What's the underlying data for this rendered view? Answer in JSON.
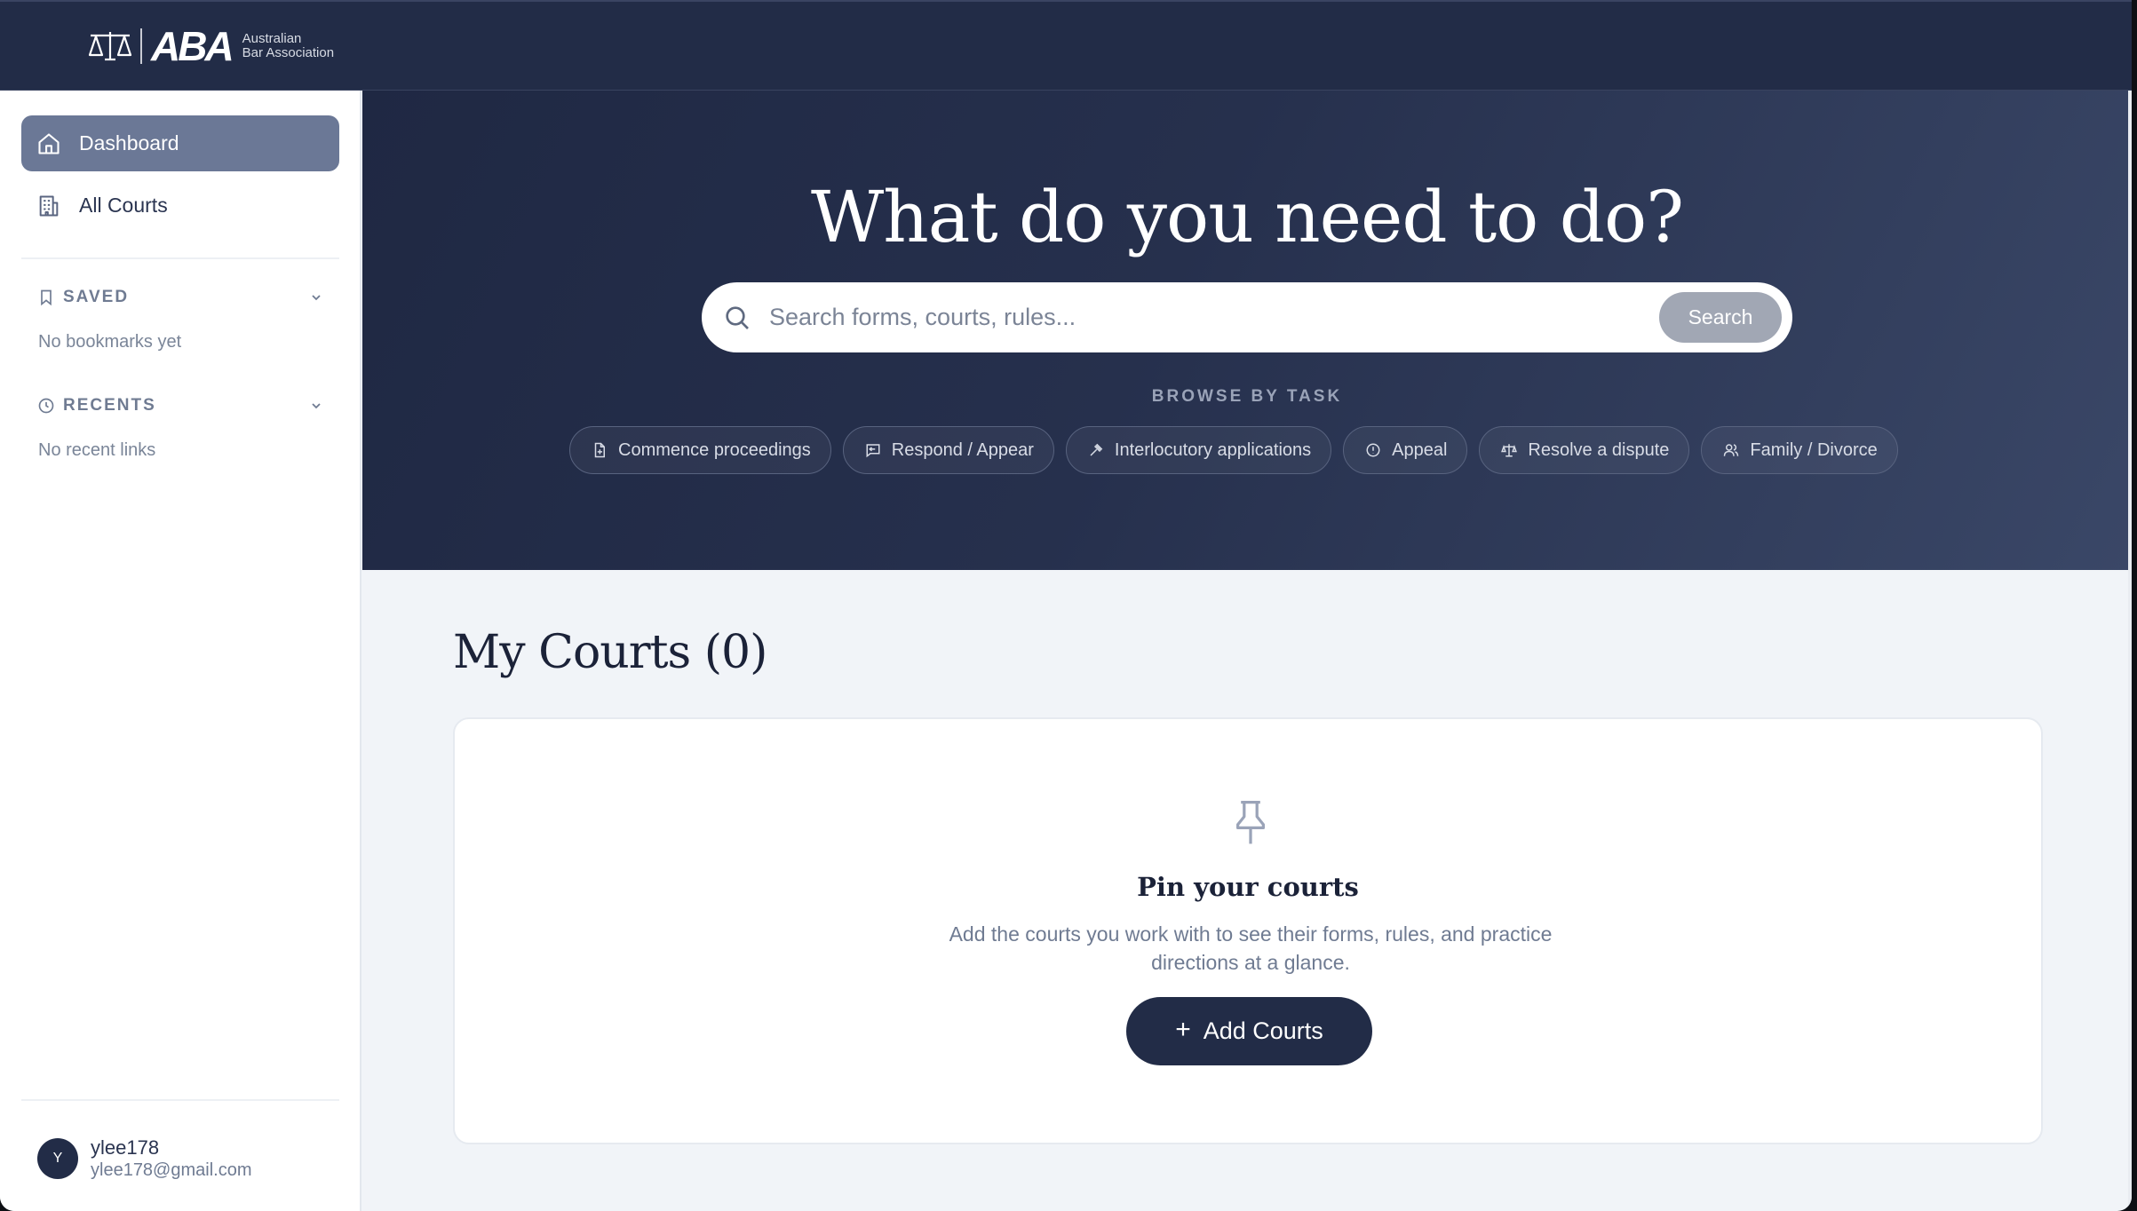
{
  "brand": {
    "mark": "ABA",
    "org_line1": "Australian",
    "org_line2": "Bar Association"
  },
  "sidebar": {
    "items": [
      {
        "label": "Dashboard",
        "icon": "home-icon",
        "active": true
      },
      {
        "label": "All Courts",
        "icon": "building-icon",
        "active": false
      }
    ],
    "saved": {
      "title": "SAVED",
      "empty": "No bookmarks yet"
    },
    "recents": {
      "title": "RECENTS",
      "empty": "No recent links"
    },
    "user": {
      "initial": "Y",
      "name": "ylee178",
      "email": "ylee178@gmail.com"
    }
  },
  "hero": {
    "title": "What do you need to do?",
    "search": {
      "placeholder": "Search forms, courts, rules...",
      "button": "Search"
    },
    "browse_label": "BROWSE BY TASK",
    "chips": [
      {
        "label": "Commence proceedings",
        "icon": "file-plus-icon"
      },
      {
        "label": "Respond / Appear",
        "icon": "message-reply-icon"
      },
      {
        "label": "Interlocutory applications",
        "icon": "gavel-icon"
      },
      {
        "label": "Appeal",
        "icon": "alert-circle-icon"
      },
      {
        "label": "Resolve a dispute",
        "icon": "scale-icon"
      },
      {
        "label": "Family / Divorce",
        "icon": "users-icon"
      }
    ]
  },
  "main": {
    "title": "My Courts (0)",
    "empty_card": {
      "heading": "Pin your courts",
      "description": "Add the courts you work with to see their forms, rules, and practice directions at a glance.",
      "button": "Add Courts",
      "button_icon": "+"
    }
  },
  "colors": {
    "navy": "#222c47",
    "active_nav": "#6b7896",
    "page_bg": "#f1f4f8"
  }
}
